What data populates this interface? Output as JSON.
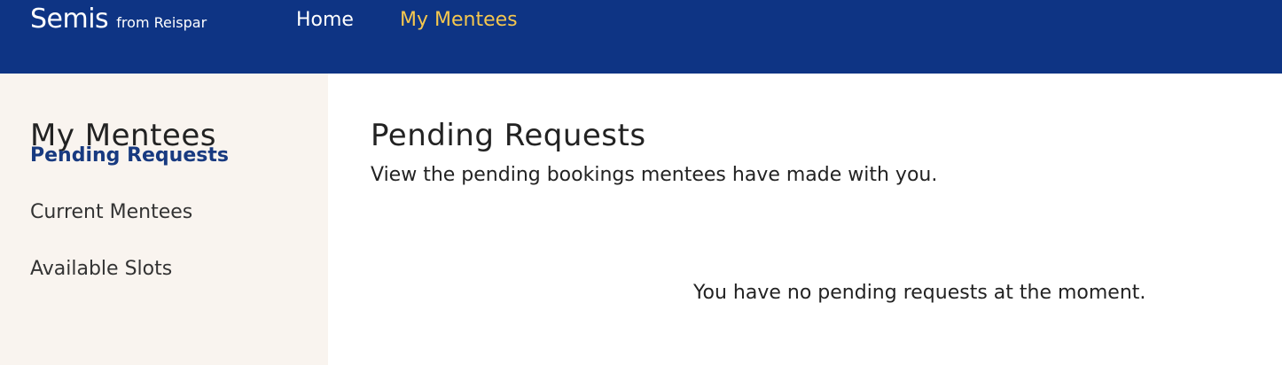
{
  "header": {
    "brand_main": "Semis",
    "brand_sub": "from Reispar",
    "nav": {
      "home": "Home",
      "my_mentees": "My Mentees"
    },
    "colors": {
      "background": "#0e3484",
      "active_nav": "#f5c74e"
    }
  },
  "sidebar": {
    "title": "My Mentees",
    "items": [
      {
        "label": "Pending Requests",
        "active": true
      },
      {
        "label": "Current Mentees",
        "active": false
      },
      {
        "label": "Available Slots",
        "active": false
      }
    ],
    "colors": {
      "background": "#f9f4ef",
      "active_item": "#183a80"
    }
  },
  "main": {
    "title": "Pending Requests",
    "description": "View the pending bookings mentees have made with you.",
    "empty_message": "You have no pending requests at the moment."
  }
}
